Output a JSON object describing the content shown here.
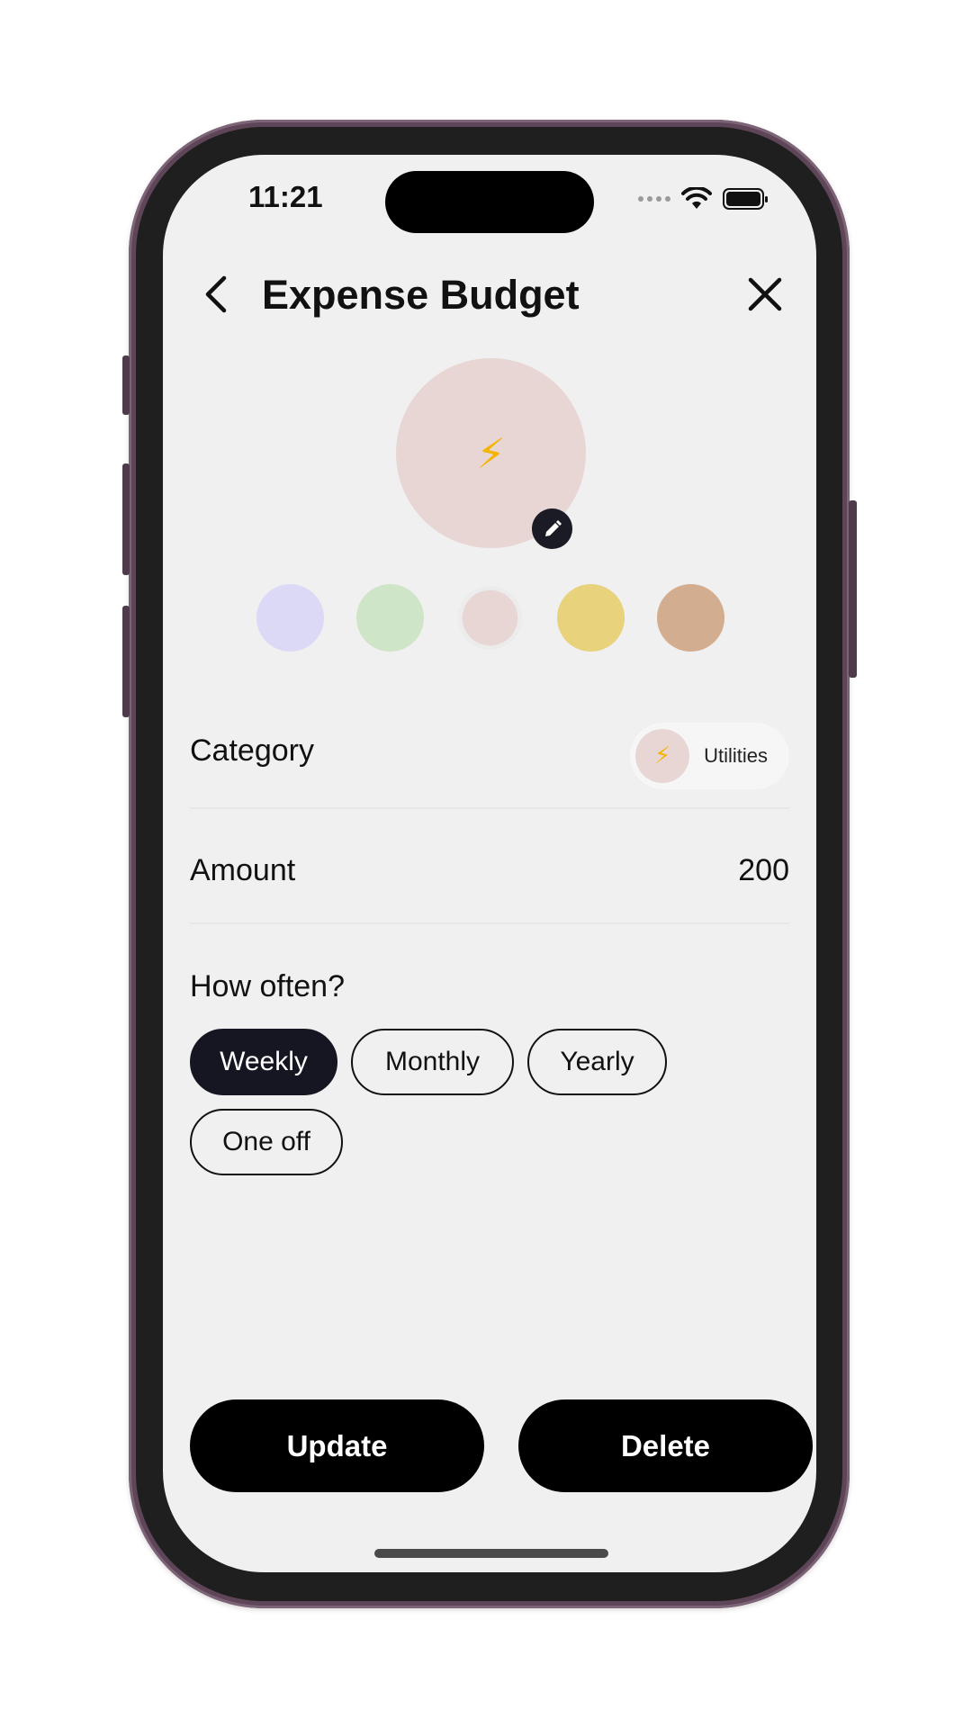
{
  "status_bar": {
    "time": "11:21"
  },
  "header": {
    "title": "Expense Budget"
  },
  "icon": {
    "emoji": "⚡",
    "name": "lightning-icon"
  },
  "color_options": [
    {
      "name": "lavender",
      "hex": "#dcd9f6",
      "selected": false
    },
    {
      "name": "mint",
      "hex": "#cfe5c8",
      "selected": false
    },
    {
      "name": "blush",
      "hex": "#e8d6d4",
      "selected": true
    },
    {
      "name": "mustard",
      "hex": "#e8d27c",
      "selected": false
    },
    {
      "name": "tan",
      "hex": "#d3ad8f",
      "selected": false
    }
  ],
  "category": {
    "label": "Category",
    "value": "Utilities",
    "emoji": "⚡"
  },
  "amount": {
    "label": "Amount",
    "value": "200"
  },
  "frequency": {
    "label": "How often?",
    "options": [
      "Weekly",
      "Monthly",
      "Yearly",
      "One off"
    ],
    "selected": "Weekly"
  },
  "actions": {
    "update_label": "Update",
    "delete_label": "Delete"
  }
}
